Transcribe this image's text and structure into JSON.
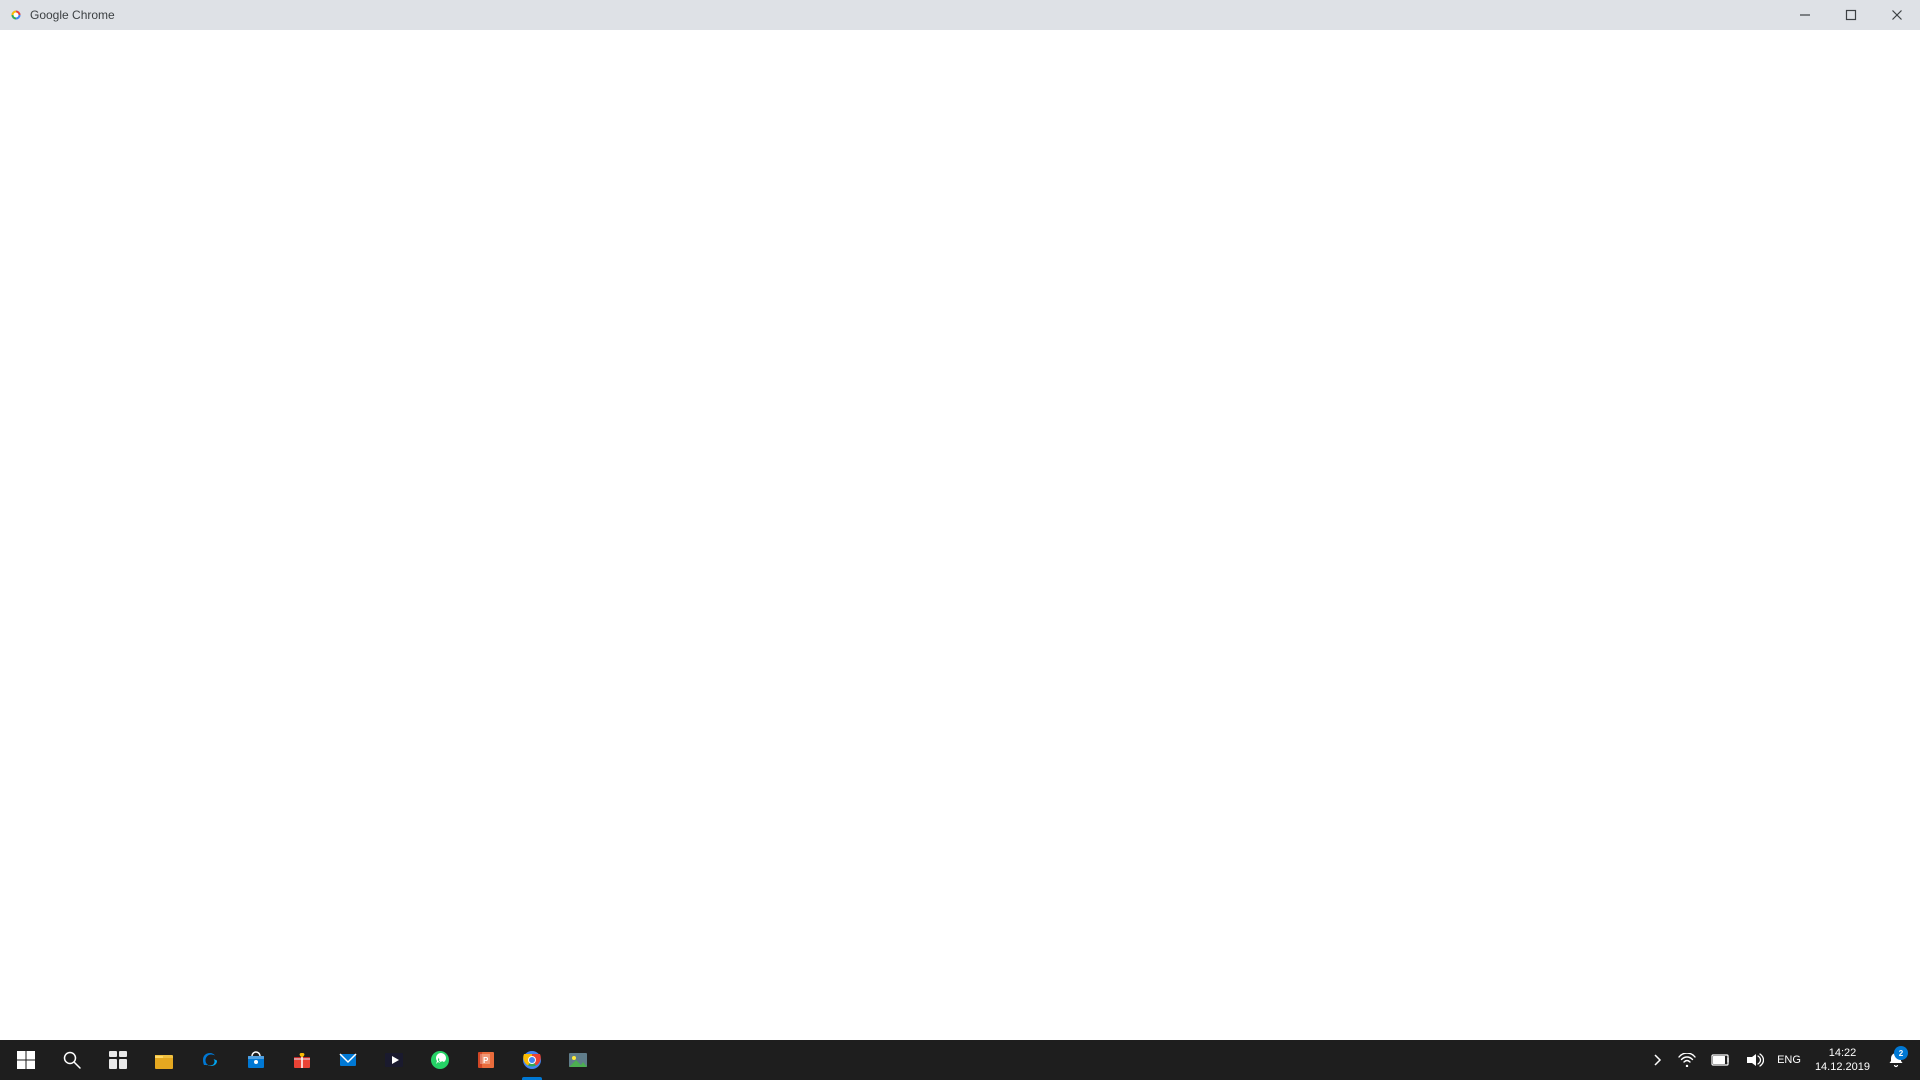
{
  "titlebar": {
    "title": "Google Chrome",
    "minimize_label": "Minimize",
    "maximize_label": "Maximize",
    "close_label": "Close"
  },
  "taskbar": {
    "start_label": "Start",
    "search_label": "Search",
    "task_view_label": "Task View",
    "icons": [
      {
        "name": "file-explorer",
        "label": "File Explorer",
        "active": false
      },
      {
        "name": "edge",
        "label": "Microsoft Edge",
        "active": false
      },
      {
        "name": "store",
        "label": "Microsoft Store",
        "active": false
      },
      {
        "name": "gift",
        "label": "Gift",
        "active": false
      },
      {
        "name": "mail",
        "label": "Mail",
        "active": false
      },
      {
        "name": "media",
        "label": "Media Player",
        "active": false
      },
      {
        "name": "whatsapp",
        "label": "WhatsApp",
        "active": false
      },
      {
        "name": "powerpoint",
        "label": "PowerPoint",
        "active": false
      },
      {
        "name": "chrome",
        "label": "Google Chrome",
        "active": true
      },
      {
        "name": "image-viewer",
        "label": "Image Viewer",
        "active": false
      }
    ],
    "tray": {
      "chevron_label": "Show hidden icons",
      "wifi_label": "Network",
      "battery_label": "Battery",
      "volume_label": "Volume",
      "language": "ENG",
      "time": "14:22",
      "date": "14.12.2019",
      "notification_label": "Notifications",
      "notification_count": "2"
    }
  }
}
